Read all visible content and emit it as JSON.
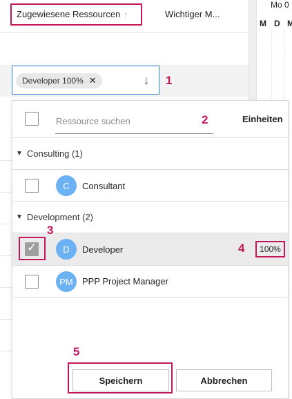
{
  "columns": {
    "sorted_label": "Zugewiesene Ressourcen",
    "sort_arrow": "↑",
    "second_label": "Wichtiger M..."
  },
  "timeline": {
    "date_label": "Mo 0",
    "days": [
      "M",
      "D",
      "M"
    ]
  },
  "editor": {
    "chip_label": "Developer 100%",
    "chip_remove": "✕",
    "toggle_arrow": "↓"
  },
  "panel": {
    "search_placeholder": "Ressource suchen",
    "units_header": "Einheiten",
    "groups": [
      {
        "label": "Consulting (1)",
        "items": [
          {
            "initials": "C",
            "name": "Consultant",
            "checked": false,
            "units": ""
          }
        ]
      },
      {
        "label": "Development (2)",
        "items": [
          {
            "initials": "D",
            "name": "Developer",
            "checked": true,
            "units": "100%"
          },
          {
            "initials": "PM",
            "name": "PPP Project Manager",
            "checked": false,
            "units": ""
          }
        ]
      }
    ],
    "save_label": "Speichern",
    "cancel_label": "Abbrechen"
  },
  "callouts": [
    "1",
    "2",
    "3",
    "4",
    "5"
  ],
  "colors": {
    "accent": "#c2185b",
    "focus_border": "#2e7bd6",
    "avatar": "#6cb1f3"
  }
}
